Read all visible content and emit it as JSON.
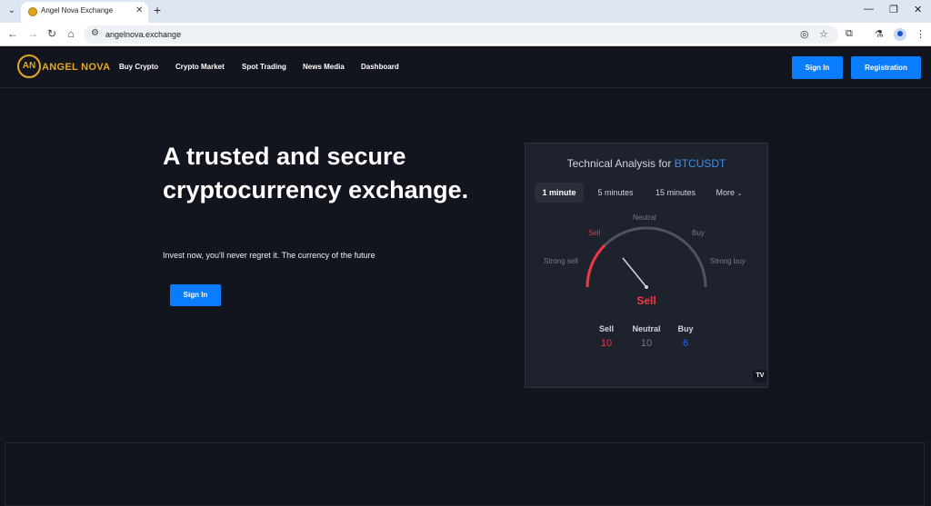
{
  "browser": {
    "tab_title": "Angel Nova Exchange",
    "url": "angelnova.exchange"
  },
  "site": {
    "logo_mark": "AN",
    "logo_text": "ANGEL NOVA",
    "nav": [
      "Buy Crypto",
      "Crypto Market",
      "Spot Trading",
      "News Media",
      "Dashboard"
    ],
    "signin_label": "Sign In",
    "registration_label": "Registration",
    "accent_color": "#0a7cff",
    "brand_color": "#e3a826"
  },
  "hero": {
    "title": "A trusted and secure cryptocurrency exchange.",
    "subtitle": "Invest now, you'll never regret it. The currency of the future",
    "cta_label": "Sign In"
  },
  "widget": {
    "title_prefix": "Technical Analysis for ",
    "symbol": "BTCUSDT",
    "tabs": [
      "1 minute",
      "5 minutes",
      "15 minutes",
      "More"
    ],
    "active_tab": "1 minute",
    "gauge_labels": {
      "strong_sell": "Strong sell",
      "sell": "Sell",
      "neutral": "Neutral",
      "buy": "Buy",
      "strong_buy": "Strong buy"
    },
    "result": "Sell",
    "counts": {
      "sell_label": "Sell",
      "sell_value": "10",
      "neutral_label": "Neutral",
      "neutral_value": "10",
      "buy_label": "Buy",
      "buy_value": "6"
    },
    "sell_color": "#f23645",
    "buy_color": "#2962ff",
    "logo": "TV"
  }
}
